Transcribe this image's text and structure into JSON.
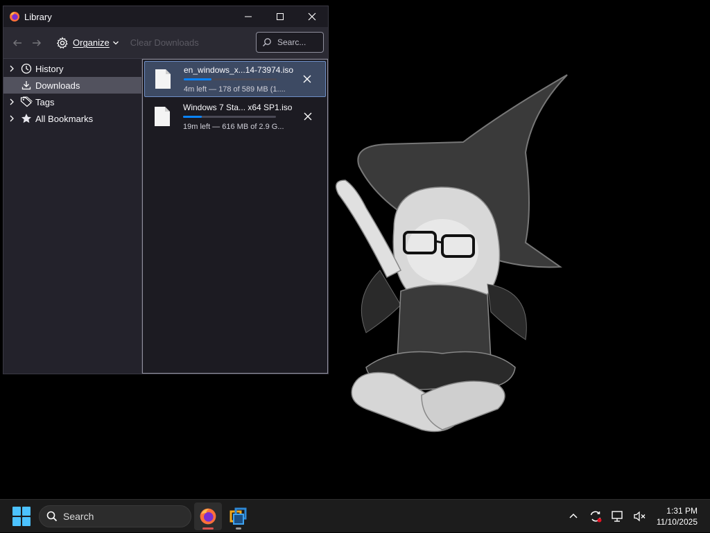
{
  "window": {
    "title": "Library",
    "minimize_label": "Minimize",
    "maximize_label": "Maximize",
    "close_label": "Close"
  },
  "toolbar": {
    "organize_label": "Organize",
    "clear_downloads_label": "Clear Downloads",
    "search_placeholder": "Searc..."
  },
  "sidebar": {
    "items": [
      {
        "label": "History",
        "icon": "clock-icon",
        "expandable": true,
        "selected": false
      },
      {
        "label": "Downloads",
        "icon": "download-icon",
        "expandable": false,
        "selected": true
      },
      {
        "label": "Tags",
        "icon": "tag-icon",
        "expandable": true,
        "selected": false
      },
      {
        "label": "All Bookmarks",
        "icon": "star-icon",
        "expandable": true,
        "selected": false
      }
    ]
  },
  "downloads": [
    {
      "name": "en_windows_x...14-73974.iso",
      "status": "4m left — 178 of 589 MB (1....",
      "progress": 0.3,
      "selected": true
    },
    {
      "name": "Windows 7 Sta... x64 SP1.iso",
      "status": "19m left — 616 MB of 2.9 G...",
      "progress": 0.2,
      "selected": false
    }
  ],
  "taskbar": {
    "search_label": "Search",
    "apps": [
      {
        "name": "firefox-icon",
        "active": true
      },
      {
        "name": "virtualbox-icon",
        "active": false
      }
    ],
    "time": "1:31 PM",
    "date": "11/10/2025"
  },
  "colors": {
    "accent": "#0a84ff",
    "window_bg": "#2b2a33",
    "selected_row": "#3d4a63"
  }
}
